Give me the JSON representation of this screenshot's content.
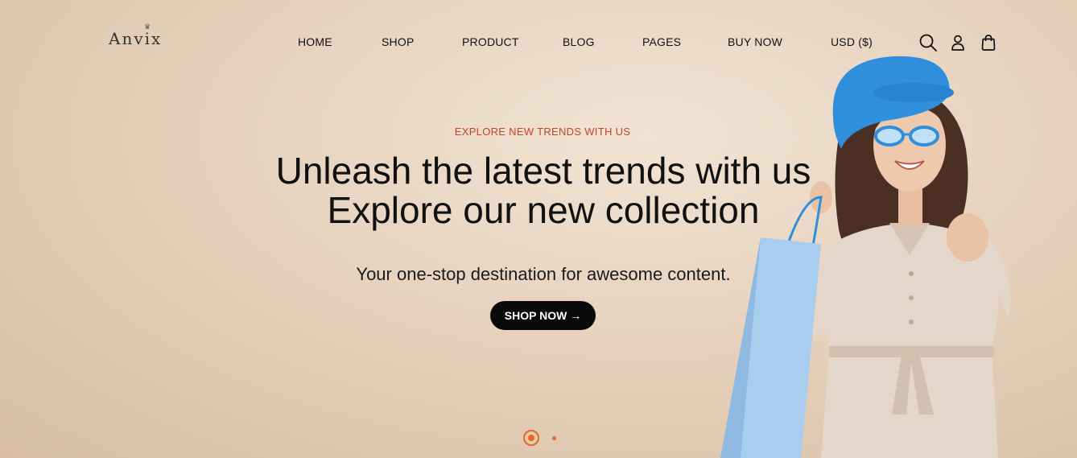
{
  "header": {
    "logo": "Anvix",
    "nav": [
      "HOME",
      "SHOP",
      "PRODUCT",
      "BLOG",
      "PAGES",
      "BUY NOW",
      "USD ($)"
    ],
    "icons": [
      "search-icon",
      "user-icon",
      "bag-icon"
    ]
  },
  "hero": {
    "eyebrow": "EXPLORE NEW TRENDS WITH US",
    "headline_line1": "Unleash the latest trends with us",
    "headline_line2": "Explore our new collection",
    "subtext": "Your one-stop destination for awesome content.",
    "cta_label": "SHOP NOW →"
  },
  "slider": {
    "current": 1,
    "total": 2
  },
  "colors": {
    "accent": "#e36a22",
    "eyebrow": "#c0462a",
    "hat": "#2f8fdc",
    "bag": "#a9cdee"
  }
}
